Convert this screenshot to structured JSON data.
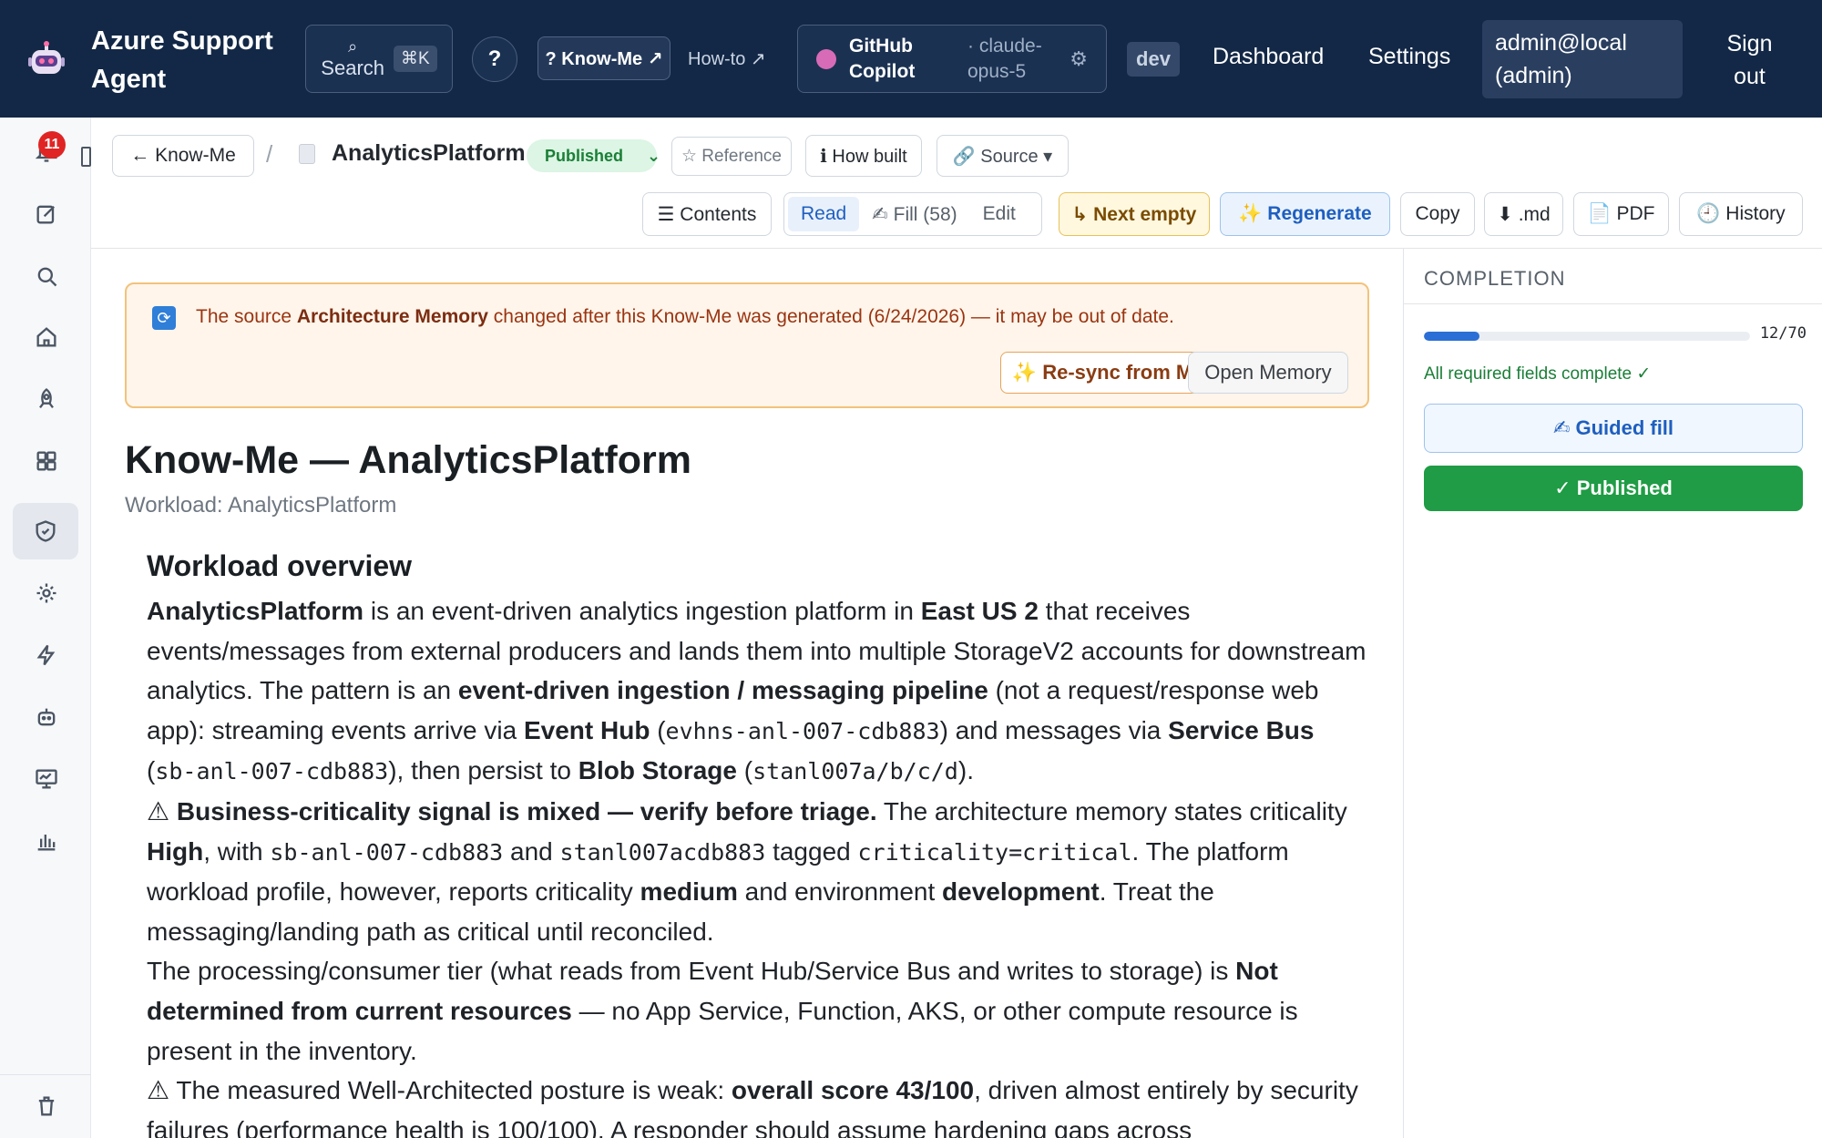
{
  "app": {
    "name": "Azure Support Agent"
  },
  "topbar": {
    "search_label": "Search",
    "search_kbd": "⌘K",
    "help": "?",
    "knowme": "? Know-Me ↗",
    "howto": "How-to ↗",
    "copilot_name": "GitHub Copilot",
    "copilot_model": "· claude-opus-5",
    "env": "dev",
    "nav_dashboard": "Dashboard",
    "nav_settings": "Settings",
    "user": "admin@local (admin)",
    "signout": "Sign out"
  },
  "rail": {
    "notif_count": "11"
  },
  "toolbar": {
    "back": "← Know-Me",
    "crumb_sep": "/",
    "doc_title": "AnalyticsPlatform",
    "status": "Published",
    "reference": "☆ Reference",
    "how_built": "ℹ How built",
    "source": "🔗 Source ▾",
    "contents": "☰ Contents",
    "read": "Read",
    "fill": "✍ Fill (58)",
    "edit": "Edit",
    "next_empty": "↳ Next empty",
    "regenerate": "✨ Regenerate",
    "copy": "Copy",
    "md": "⬇ .md",
    "pdf": "📄 PDF",
    "history": "🕘 History"
  },
  "banner": {
    "pre": "The source ",
    "source_name": "Architecture Memory",
    "post": " changed after this Know-Me was generated (6/24/2026) — it may be out of date.",
    "resync": "✨ Re-sync from Memory",
    "open": "Open Memory"
  },
  "doc": {
    "title": "Know-Me — AnalyticsPlatform",
    "subtitle": "Workload: AnalyticsPlatform",
    "section_title": "Workload overview"
  },
  "completion": {
    "title": "COMPLETION",
    "progress": 0.171,
    "count": "12/70",
    "status": "All required fields complete ✓",
    "guided": "✍ Guided fill",
    "published": "✓ Published"
  }
}
